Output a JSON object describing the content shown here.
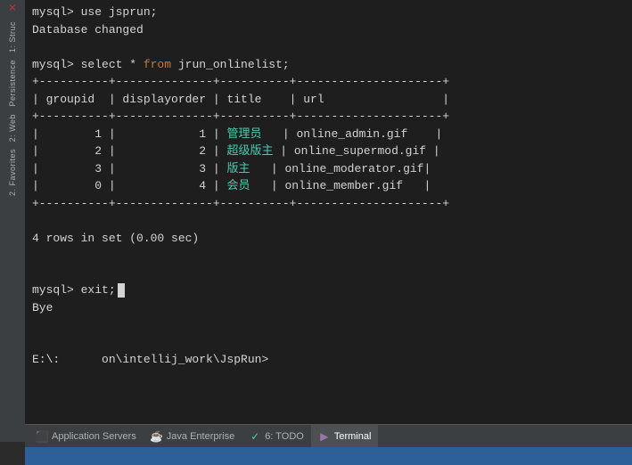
{
  "sidebar": {
    "close_icon": "×",
    "items": [
      {
        "label": "1: Struc",
        "id": "structure"
      },
      {
        "label": "Persistence",
        "id": "persistence"
      },
      {
        "label": "2: Web",
        "id": "web"
      },
      {
        "label": "2. Favorites",
        "id": "favorites"
      }
    ]
  },
  "terminal": {
    "lines": [
      {
        "type": "cmd",
        "text": "mysql> use jsprun;"
      },
      {
        "type": "output",
        "text": "Database changed"
      },
      {
        "type": "blank",
        "text": ""
      },
      {
        "type": "cmd",
        "text": "mysql> select * from jrun_onlinelist;"
      },
      {
        "type": "border",
        "text": "+----------+--------------+----------+---------------------+"
      },
      {
        "type": "header",
        "text": "| groupid  | displayorder | title    | url                 |"
      },
      {
        "type": "border",
        "text": "+----------+--------------+----------+---------------------+"
      },
      {
        "type": "row",
        "groupid": "1",
        "displayorder": "1",
        "title": "管理员",
        "url": "online_admin.gif"
      },
      {
        "type": "row",
        "groupid": "2",
        "displayorder": "2",
        "title": "超级版主",
        "url": "online_supermod.gif"
      },
      {
        "type": "row",
        "groupid": "3",
        "displayorder": "3",
        "title": "版主",
        "url": "online_moderator.gif"
      },
      {
        "type": "row",
        "groupid": "0",
        "displayorder": "4",
        "title": "会员",
        "url": "online_member.gif"
      },
      {
        "type": "border",
        "text": "+----------+--------------+----------+---------------------+"
      },
      {
        "type": "blank",
        "text": ""
      },
      {
        "type": "output",
        "text": "4 rows in set (0.00 sec)"
      },
      {
        "type": "blank",
        "text": ""
      },
      {
        "type": "blank",
        "text": ""
      },
      {
        "type": "exit_cmd",
        "text": "mysql> exit;"
      },
      {
        "type": "output",
        "text": "Bye"
      },
      {
        "type": "blank",
        "text": ""
      },
      {
        "type": "blank",
        "text": ""
      },
      {
        "type": "prompt",
        "text": "E:\\:      on\\intellij_work\\JspRun>"
      }
    ]
  },
  "toolbar": {
    "items": [
      {
        "id": "app-servers",
        "label": "Application Servers",
        "icon": "⬛"
      },
      {
        "id": "java-enterprise",
        "label": "Java Enterprise",
        "icon": "☕"
      },
      {
        "id": "todo",
        "label": "6: TODO",
        "icon": "✓"
      },
      {
        "id": "terminal",
        "label": "Terminal",
        "icon": "▶",
        "active": true
      }
    ]
  },
  "status_bar": {
    "text": ""
  }
}
